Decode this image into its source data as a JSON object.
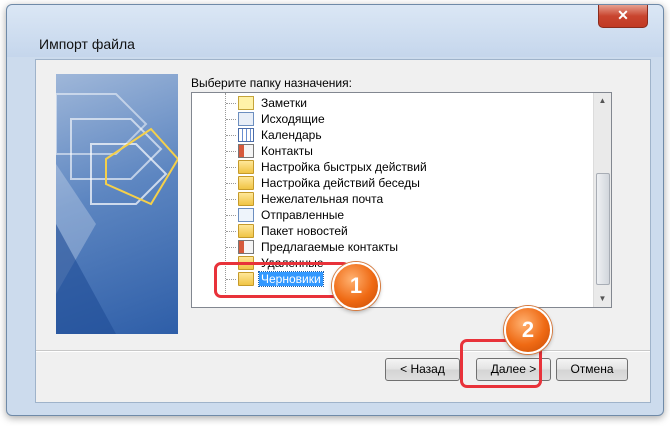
{
  "window": {
    "title": "Импорт файла",
    "close_glyph": "✕"
  },
  "dialog": {
    "prompt": "Выберите папку назначения:",
    "folders": [
      {
        "label": "Заметки",
        "icon": "note-icon"
      },
      {
        "label": "Исходящие",
        "icon": "outbox-icon"
      },
      {
        "label": "Календарь",
        "icon": "calendar-icon"
      },
      {
        "label": "Контакты",
        "icon": "contacts-icon"
      },
      {
        "label": "Настройка быстрых действий",
        "icon": "folder-icon"
      },
      {
        "label": "Настройка действий беседы",
        "icon": "folder-icon"
      },
      {
        "label": "Нежелательная почта",
        "icon": "folder-icon"
      },
      {
        "label": "Отправленные",
        "icon": "sent-icon"
      },
      {
        "label": "Пакет новостей",
        "icon": "folder-icon"
      },
      {
        "label": "Предлагаемые контакты",
        "icon": "contacts-icon"
      },
      {
        "label": "Удаленные",
        "icon": "folder-icon"
      },
      {
        "label": "Черновики",
        "icon": "folder-icon",
        "selected": true
      }
    ],
    "buttons": {
      "back": "< Назад",
      "next": "Далее >",
      "cancel": "Отмена"
    }
  },
  "annotations": {
    "step1": "1",
    "step2": "2"
  },
  "colors": {
    "selection": "#3399ff",
    "callout_red": "#e8323a",
    "badge_orange": "#ef6a14"
  }
}
